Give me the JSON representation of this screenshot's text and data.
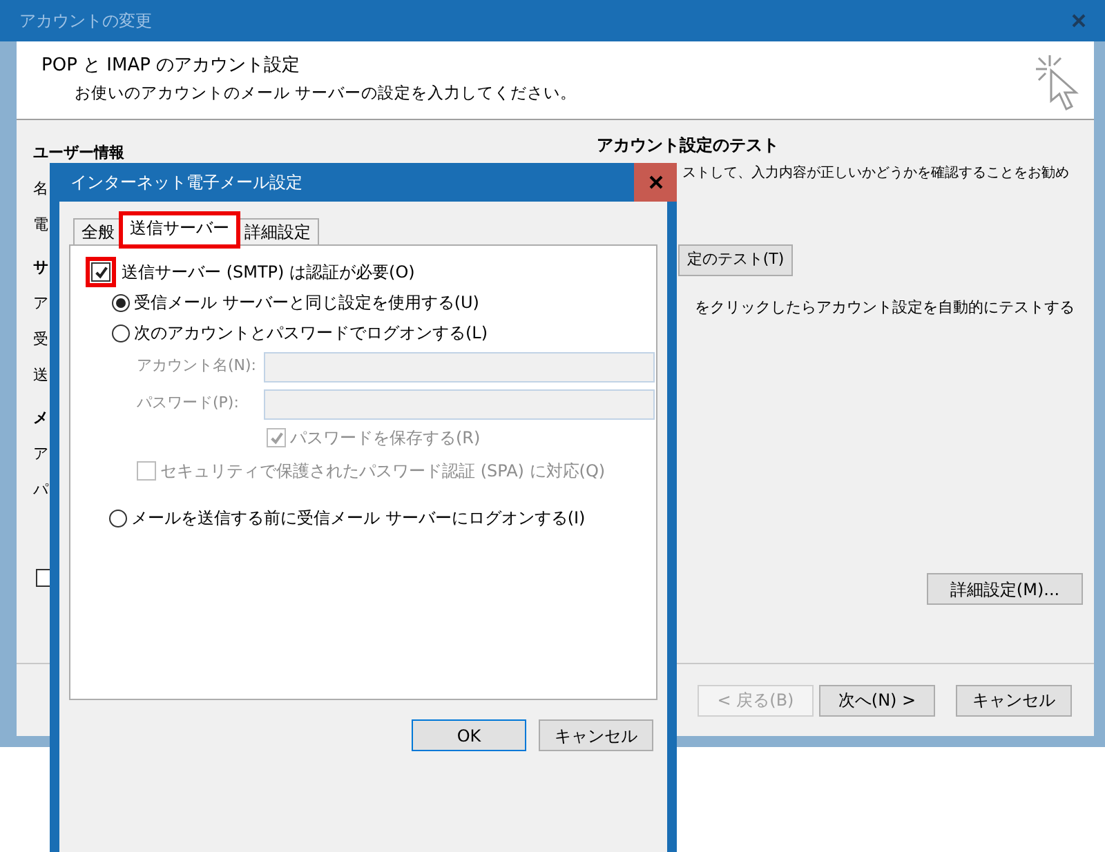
{
  "window": {
    "title": "アカウントの変更"
  },
  "header": {
    "title": "POP と IMAP のアカウント設定",
    "subtitle": "お使いのアカウントのメール サーバーの設定を入力してください。"
  },
  "left_labels": [
    {
      "text": "ユーザー情報",
      "kind": "heading"
    },
    {
      "text": "名",
      "kind": "label"
    },
    {
      "text": "電",
      "kind": "label"
    },
    {
      "text": "サ",
      "kind": "heading"
    },
    {
      "text": "ア",
      "kind": "label"
    },
    {
      "text": "受",
      "kind": "label"
    },
    {
      "text": "送",
      "kind": "label"
    },
    {
      "text": "メ",
      "kind": "heading"
    },
    {
      "text": "ア",
      "kind": "label"
    },
    {
      "text": "パ",
      "kind": "label"
    }
  ],
  "left_checkbox": {
    "checked": false
  },
  "test_section": {
    "heading": "アカウント設定のテスト",
    "note": "ストして、入力内容が正しいかどうかを確認することをお勧め",
    "test_button": "定のテスト(T)",
    "auto_test_text": "をクリックしたらアカウント設定を自動的にテストする",
    "more_button": "詳細設定(M)..."
  },
  "footer_buttons": [
    {
      "label": "< 戻る(B)",
      "disabled": true
    },
    {
      "label": "次へ(N) >",
      "disabled": false
    },
    {
      "label": "キャンセル",
      "disabled": false
    }
  ],
  "dialog": {
    "title": "インターネット電子メール設定",
    "tabs": [
      {
        "label": "全般",
        "selected": false,
        "highlighted": false
      },
      {
        "label": "送信サーバー",
        "selected": true,
        "highlighted": true
      },
      {
        "label": "詳細設定",
        "selected": false,
        "highlighted": false
      }
    ],
    "smtp_auth": {
      "label": "送信サーバー (SMTP) は認証が必要(O)",
      "checked": true,
      "highlighted": true
    },
    "radios": [
      {
        "label": "受信メール サーバーと同じ設定を使用する(U)",
        "selected": true
      },
      {
        "label": "次のアカウントとパスワードでログオンする(L)",
        "selected": false
      },
      {
        "label": "メールを送信する前に受信メール サーバーにログオンする(I)",
        "selected": false
      }
    ],
    "fields": [
      {
        "label": "アカウント名(N):",
        "disabled": true
      },
      {
        "label": "パスワード(P):",
        "disabled": true
      }
    ],
    "save_password": {
      "label": "パスワードを保存する(R)",
      "checked": true,
      "disabled": true
    },
    "spa": {
      "label": "セキュリティで保護されたパスワード認証 (SPA) に対応(Q)",
      "checked": false,
      "disabled": true
    },
    "buttons": [
      {
        "label": "OK",
        "default": true
      },
      {
        "label": "キャンセル",
        "default": false
      }
    ]
  }
}
